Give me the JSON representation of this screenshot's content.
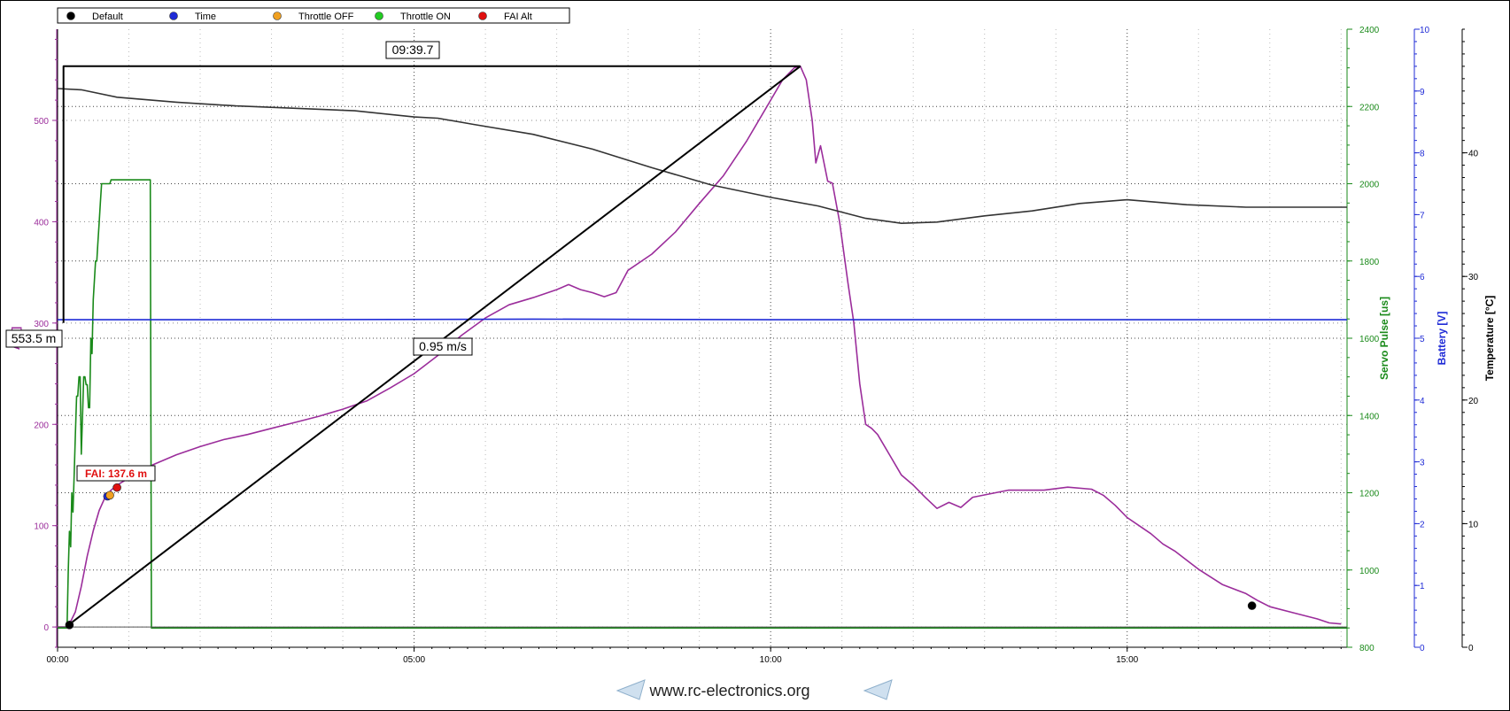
{
  "legend": [
    {
      "label": "Default",
      "color": "#000000"
    },
    {
      "label": "Time",
      "color": "#1f2bd6"
    },
    {
      "label": "Throttle OFF",
      "color": "#f0a020"
    },
    {
      "label": "Throttle ON",
      "color": "#22cc22"
    },
    {
      "label": "FAI Alt",
      "color": "#e01010"
    }
  ],
  "annotations": {
    "max_time": "09:39.7",
    "max_alt": "553.5 m",
    "climb_rate": "0.95 m/s",
    "fai": "FAI: 137.6 m"
  },
  "watermark": "www.rc-electronics.org",
  "colors": {
    "altitude": "#9b2d9b",
    "servo": "#1a8a1a",
    "battery": "#1f2bd6",
    "temperature": "#333333",
    "marker_line": "#000000"
  },
  "chart_data": {
    "type": "line",
    "x_axis": {
      "unit": "time (s)",
      "range": [
        0,
        1085
      ],
      "ticks": [
        {
          "value": 0,
          "label": "00:00"
        },
        {
          "value": 300,
          "label": "05:00"
        },
        {
          "value": 600,
          "label": "10:00"
        },
        {
          "value": 900,
          "label": "15:00"
        }
      ]
    },
    "y_axes": [
      {
        "id": "alt",
        "title": "Altitude [m]",
        "visible_title": "A   m]",
        "side": "left",
        "range": [
          -20,
          590
        ],
        "ticks": [
          0,
          100,
          200,
          300,
          400,
          500
        ],
        "color": "#9b2d9b"
      },
      {
        "id": "servo",
        "title": "Servo Pulse [us]",
        "side": "right",
        "range": [
          800,
          2400
        ],
        "ticks": [
          800,
          1000,
          1200,
          1400,
          1600,
          1800,
          2000,
          2200,
          2400
        ],
        "color": "#1a8a1a"
      },
      {
        "id": "battery",
        "title": "Battery [V]",
        "side": "right",
        "range": [
          0,
          10
        ],
        "ticks": [
          0,
          1,
          2,
          3,
          4,
          5,
          6,
          7,
          8,
          9,
          10
        ],
        "color": "#1f2bd6"
      },
      {
        "id": "temp",
        "title": "Temperature [°C]",
        "side": "right",
        "range": [
          0,
          50
        ],
        "ticks": [
          0,
          10,
          20,
          30,
          40
        ],
        "color": "#000000"
      }
    ],
    "series": [
      {
        "id": "altitude",
        "axis": "alt",
        "color": "#9b2d9b",
        "points": [
          [
            0,
            0
          ],
          [
            7,
            0
          ],
          [
            10,
            3
          ],
          [
            15,
            15
          ],
          [
            20,
            40
          ],
          [
            25,
            70
          ],
          [
            30,
            95
          ],
          [
            35,
            115
          ],
          [
            40,
            128
          ],
          [
            45,
            135
          ],
          [
            50,
            140
          ],
          [
            60,
            147
          ],
          [
            70,
            152
          ],
          [
            80,
            160
          ],
          [
            100,
            170
          ],
          [
            120,
            178
          ],
          [
            140,
            185
          ],
          [
            160,
            190
          ],
          [
            180,
            196
          ],
          [
            200,
            202
          ],
          [
            220,
            208
          ],
          [
            240,
            215
          ],
          [
            260,
            223
          ],
          [
            280,
            236
          ],
          [
            300,
            250
          ],
          [
            320,
            268
          ],
          [
            340,
            288
          ],
          [
            360,
            305
          ],
          [
            380,
            318
          ],
          [
            400,
            325
          ],
          [
            420,
            333
          ],
          [
            430,
            338
          ],
          [
            440,
            333
          ],
          [
            450,
            330
          ],
          [
            460,
            326
          ],
          [
            470,
            330
          ],
          [
            480,
            352
          ],
          [
            500,
            368
          ],
          [
            520,
            390
          ],
          [
            540,
            418
          ],
          [
            560,
            445
          ],
          [
            580,
            480
          ],
          [
            600,
            520
          ],
          [
            610,
            540
          ],
          [
            620,
            552
          ],
          [
            625,
            553.5
          ],
          [
            630,
            540
          ],
          [
            635,
            500
          ],
          [
            638,
            458
          ],
          [
            642,
            475
          ],
          [
            648,
            440
          ],
          [
            652,
            438
          ],
          [
            658,
            400
          ],
          [
            665,
            340
          ],
          [
            670,
            300
          ],
          [
            675,
            240
          ],
          [
            680,
            200
          ],
          [
            685,
            196
          ],
          [
            690,
            190
          ],
          [
            700,
            170
          ],
          [
            710,
            150
          ],
          [
            720,
            140
          ],
          [
            730,
            128
          ],
          [
            740,
            117
          ],
          [
            750,
            123
          ],
          [
            760,
            118
          ],
          [
            770,
            128
          ],
          [
            800,
            135
          ],
          [
            830,
            135
          ],
          [
            850,
            138
          ],
          [
            870,
            136
          ],
          [
            880,
            130
          ],
          [
            890,
            120
          ],
          [
            900,
            108
          ],
          [
            910,
            100
          ],
          [
            920,
            92
          ],
          [
            930,
            82
          ],
          [
            940,
            75
          ],
          [
            960,
            57
          ],
          [
            980,
            42
          ],
          [
            1000,
            33
          ],
          [
            1010,
            26
          ],
          [
            1020,
            20
          ],
          [
            1040,
            14
          ],
          [
            1060,
            8
          ],
          [
            1070,
            4
          ],
          [
            1080,
            3
          ]
        ]
      },
      {
        "id": "servo",
        "axis": "servo",
        "color": "#1a8a1a",
        "points": [
          [
            0,
            850
          ],
          [
            8,
            850
          ],
          [
            9,
            1000
          ],
          [
            10,
            1100
          ],
          [
            11,
            1060
          ],
          [
            12,
            1200
          ],
          [
            13,
            1150
          ],
          [
            14,
            1250
          ],
          [
            15,
            1350
          ],
          [
            16,
            1450
          ],
          [
            17,
            1450
          ],
          [
            18,
            1500
          ],
          [
            19,
            1500
          ],
          [
            20,
            1300
          ],
          [
            21,
            1400
          ],
          [
            22,
            1500
          ],
          [
            23,
            1500
          ],
          [
            24,
            1480
          ],
          [
            25,
            1480
          ],
          [
            26,
            1420
          ],
          [
            27,
            1420
          ],
          [
            28,
            1600
          ],
          [
            29,
            1560
          ],
          [
            30,
            1700
          ],
          [
            31,
            1750
          ],
          [
            32,
            1800
          ],
          [
            33,
            1800
          ],
          [
            34,
            1850
          ],
          [
            35,
            1900
          ],
          [
            36,
            1950
          ],
          [
            37,
            2000
          ],
          [
            38,
            2000
          ],
          [
            44,
            2000
          ],
          [
            45,
            2010
          ],
          [
            78,
            2010
          ],
          [
            79,
            850
          ],
          [
            1085,
            850
          ]
        ]
      },
      {
        "id": "battery",
        "axis": "battery",
        "color": "#1f2bd6",
        "points": [
          [
            0,
            5.3
          ],
          [
            200,
            5.3
          ],
          [
            400,
            5.31
          ],
          [
            600,
            5.3
          ],
          [
            800,
            5.3
          ],
          [
            1085,
            5.3
          ]
        ]
      },
      {
        "id": "temperature",
        "axis": "temp",
        "color": "#333333",
        "points": [
          [
            0,
            45.2
          ],
          [
            20,
            45.1
          ],
          [
            50,
            44.5
          ],
          [
            100,
            44.1
          ],
          [
            150,
            43.8
          ],
          [
            200,
            43.6
          ],
          [
            250,
            43.4
          ],
          [
            300,
            42.9
          ],
          [
            320,
            42.8
          ],
          [
            350,
            42.3
          ],
          [
            400,
            41.5
          ],
          [
            450,
            40.3
          ],
          [
            500,
            38.8
          ],
          [
            550,
            37.4
          ],
          [
            600,
            36.4
          ],
          [
            640,
            35.7
          ],
          [
            680,
            34.7
          ],
          [
            710,
            34.3
          ],
          [
            740,
            34.4
          ],
          [
            780,
            34.9
          ],
          [
            820,
            35.3
          ],
          [
            860,
            35.9
          ],
          [
            900,
            36.2
          ],
          [
            950,
            35.8
          ],
          [
            1000,
            35.6
          ],
          [
            1085,
            35.6
          ]
        ]
      },
      {
        "id": "climb-line",
        "axis": "alt",
        "color": "#000000",
        "points": [
          [
            7,
            0
          ],
          [
            625,
            553.5
          ]
        ]
      },
      {
        "id": "max-bracket",
        "axis": "alt",
        "color": "#000000",
        "points": [
          [
            5,
            300
          ],
          [
            5,
            553.5
          ],
          [
            625,
            553.5
          ]
        ]
      }
    ],
    "markers": [
      {
        "type": "Default",
        "x": 10,
        "y": 2,
        "color": "#000000"
      },
      {
        "type": "Time",
        "x": 42,
        "y": 129,
        "color": "#1f2bd6"
      },
      {
        "type": "Throttle OFF",
        "x": 44,
        "y": 130,
        "color": "#f0a020"
      },
      {
        "type": "FAI Alt",
        "x": 50,
        "y": 137.6,
        "color": "#e01010"
      },
      {
        "type": "Default",
        "x": 1005,
        "y": 21,
        "color": "#000000"
      }
    ]
  }
}
